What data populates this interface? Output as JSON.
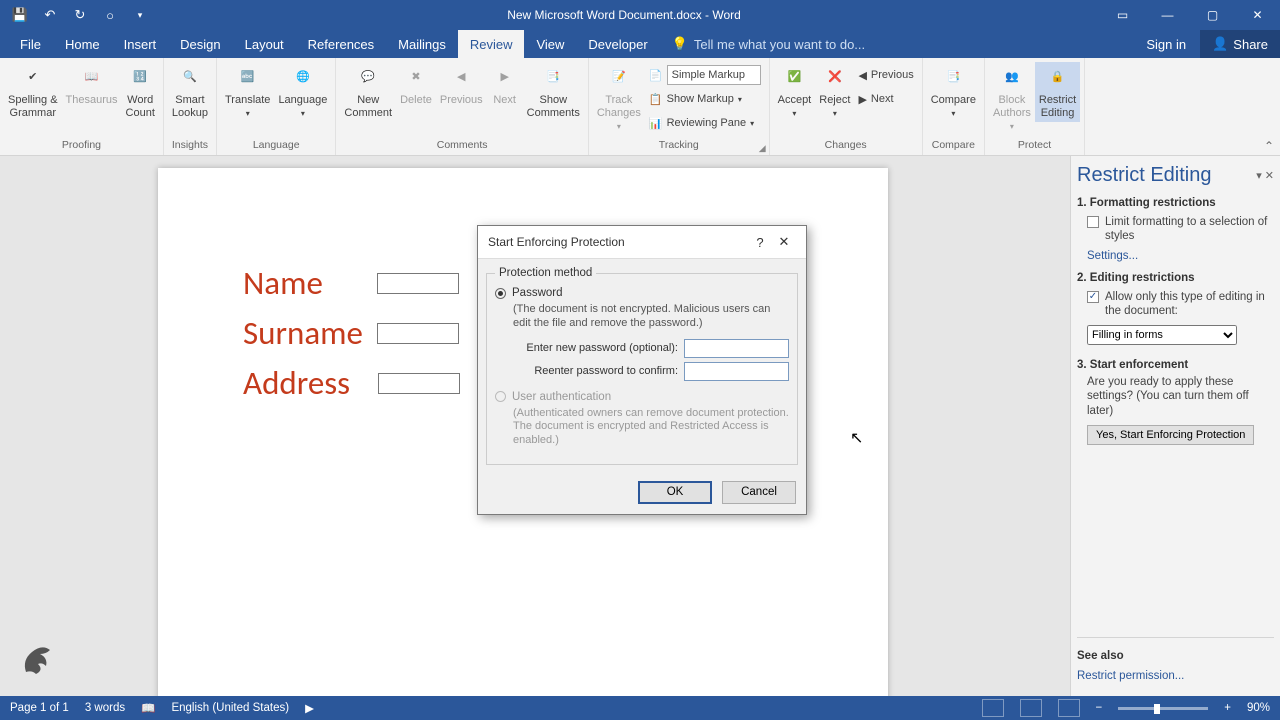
{
  "titlebar": {
    "title": "New Microsoft Word Document.docx - Word"
  },
  "tabs": {
    "file": "File",
    "home": "Home",
    "insert": "Insert",
    "design": "Design",
    "layout": "Layout",
    "references": "References",
    "mailings": "Mailings",
    "review": "Review",
    "view": "View",
    "developer": "Developer",
    "tellme": "Tell me what you want to do...",
    "signin": "Sign in",
    "share": "Share"
  },
  "ribbon": {
    "proofing": {
      "label": "Proofing",
      "spelling": "Spelling &\nGrammar",
      "thesaurus": "Thesaurus",
      "wordcount": "Word\nCount"
    },
    "insights": {
      "label": "Insights",
      "smart": "Smart\nLookup"
    },
    "language": {
      "label": "Language",
      "translate": "Translate",
      "language": "Language"
    },
    "comments": {
      "label": "Comments",
      "new": "New\nComment",
      "delete": "Delete",
      "previous": "Previous",
      "next": "Next",
      "show": "Show\nComments"
    },
    "tracking": {
      "label": "Tracking",
      "track": "Track\nChanges",
      "simple": "Simple Markup",
      "showmarkup": "Show Markup",
      "reviewing": "Reviewing Pane"
    },
    "changes": {
      "label": "Changes",
      "accept": "Accept",
      "reject": "Reject",
      "prev": "Previous",
      "next": "Next"
    },
    "compare": {
      "label": "Compare",
      "compare": "Compare"
    },
    "protect": {
      "label": "Protect",
      "block": "Block\nAuthors",
      "restrict": "Restrict\nEditing"
    }
  },
  "form": {
    "name": "Name",
    "surname": "Surname",
    "address": "Address"
  },
  "sidebar": {
    "title": "Restrict Editing",
    "s1": "1. Formatting restrictions",
    "s1_chk": "Limit formatting to a selection of styles",
    "s1_link": "Settings...",
    "s2": "2. Editing restrictions",
    "s2_chk": "Allow only this type of editing in the document:",
    "s2_select": "Filling in forms",
    "s3": "3. Start enforcement",
    "s3_desc": "Are you ready to apply these settings? (You can turn them off later)",
    "s3_btn": "Yes, Start Enforcing Protection",
    "seealso": "See also",
    "seealso_link": "Restrict permission..."
  },
  "dialog": {
    "title": "Start Enforcing Protection",
    "fieldset": "Protection method",
    "r1": "Password",
    "r1_hint": "(The document is not encrypted. Malicious users can edit the file and remove the password.)",
    "pw1": "Enter new password (optional):",
    "pw2": "Reenter password to confirm:",
    "r2": "User authentication",
    "r2_hint": "(Authenticated owners can remove document protection. The document is encrypted and Restricted Access is enabled.)",
    "ok": "OK",
    "cancel": "Cancel"
  },
  "status": {
    "page": "Page 1 of 1",
    "words": "3 words",
    "lang": "English (United States)",
    "zoom": "90%"
  }
}
